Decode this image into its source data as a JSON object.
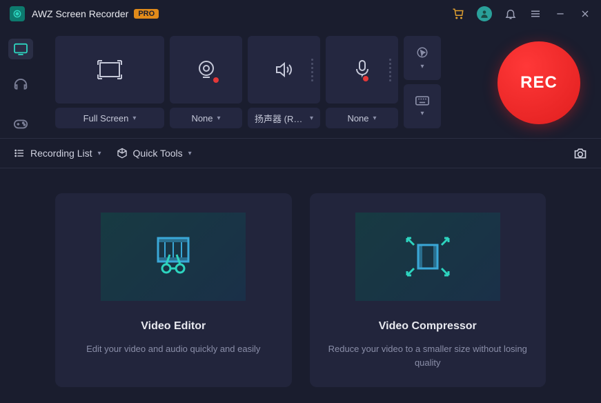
{
  "title": "AWZ Screen Recorder",
  "pro_badge": "PRO",
  "controls": {
    "region": {
      "dropdown": "Full Screen"
    },
    "webcam": {
      "dropdown": "None"
    },
    "speaker": {
      "dropdown": "扬声器 (Rea..."
    },
    "mic": {
      "dropdown": "None"
    }
  },
  "rec_button": "REC",
  "toolbar": {
    "recording_list": "Recording List",
    "quick_tools": "Quick Tools"
  },
  "cards": {
    "editor": {
      "title": "Video Editor",
      "desc": "Edit your video and audio quickly and easily"
    },
    "compressor": {
      "title": "Video Compressor",
      "desc": "Reduce your video to a smaller size without losing quality"
    }
  }
}
